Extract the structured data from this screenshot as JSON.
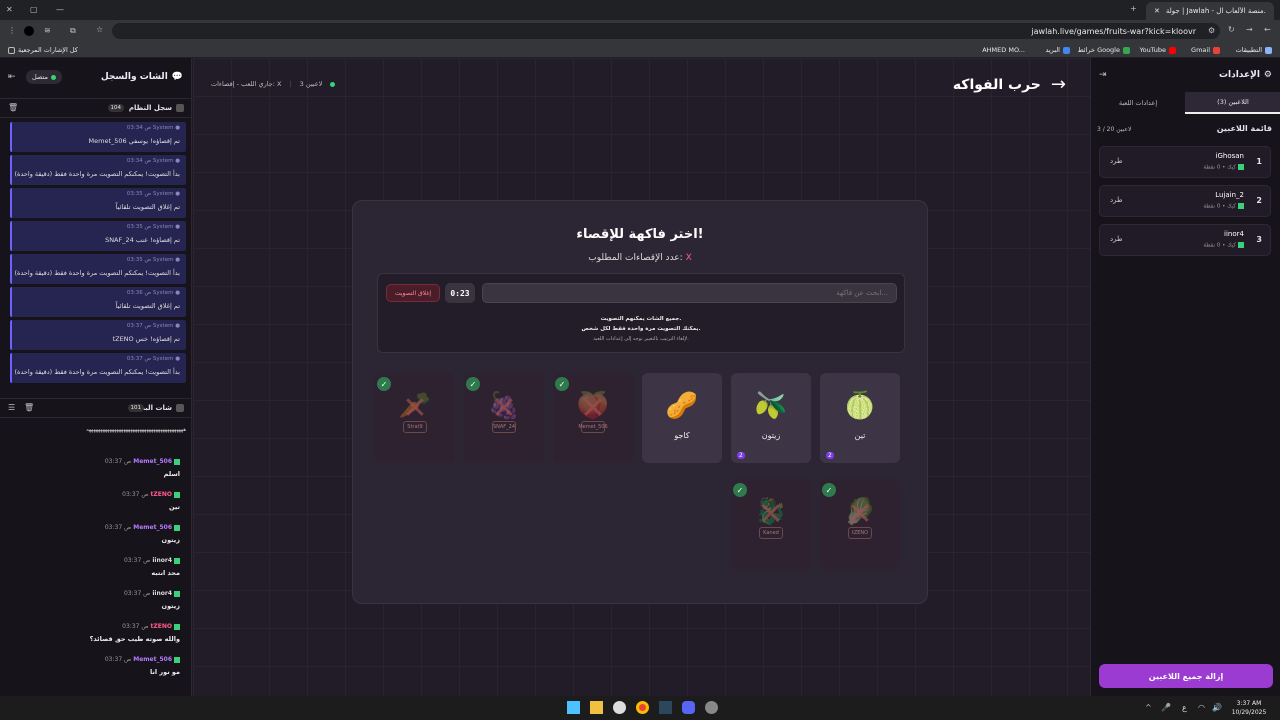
{
  "browser": {
    "tab_title": "جولة | Jawlah - منصة الألعاب ال...",
    "url": "jawlah.live/games/fruits-war?kick=kloovr",
    "bookmarks": [
      "التطبيقات",
      "Gmail",
      "YouTube",
      "خرائط Google",
      "البريد",
      "AHMED MO...",
      "كل الإشارات المرجعية"
    ]
  },
  "left": {
    "title": "الشات والسجل",
    "status": "متصل",
    "system_log_title": "سجل النظام",
    "system_log_count": "104",
    "system_messages": [
      {
        "sender": "System",
        "time": "03:34 ص",
        "text": "Memet_506 تم إقصاؤه! يوسفي"
      },
      {
        "sender": "System",
        "time": "03:34 ص",
        "text": "بدأ التصويت! يمكنكم التصويت مرة واحدة فقط (دقيقة واحدة)"
      },
      {
        "sender": "System",
        "time": "03:35 ص",
        "text": "تم إغلاق التصويت تلقائياً"
      },
      {
        "sender": "System",
        "time": "03:35 ص",
        "text": "SNAF_24 تم إقصاؤه! عنب"
      },
      {
        "sender": "System",
        "time": "03:35 ص",
        "text": "بدأ التصويت! يمكنكم التصويت مرة واحدة فقط (دقيقة واحدة)"
      },
      {
        "sender": "System",
        "time": "03:36 ص",
        "text": "تم إغلاق التصويت تلقائياً"
      },
      {
        "sender": "System",
        "time": "03:37 ص",
        "text": "tZENO تم إقصاؤه! خس"
      },
      {
        "sender": "System",
        "time": "03:37 ص",
        "text": "بدأ التصويت! يمكنكم التصويت مرة واحدة فقط (دقيقة واحدة)"
      }
    ],
    "chat_title": "شات البث",
    "chat_count": "101",
    "chat_spam": "ههههههههههههههههههههههههههههههههههههههههههه",
    "chat_messages": [
      {
        "user": "Memet_506",
        "time": "03:37 ص",
        "text": "اسلم",
        "color": "#b47cff"
      },
      {
        "user": "tZENO",
        "time": "03:37 ص",
        "text": "تين",
        "color": "#ff5c8a"
      },
      {
        "user": "Memet_506",
        "time": "03:37 ص",
        "text": "زيتون",
        "color": "#b47cff"
      },
      {
        "user": "iinor4",
        "time": "03:37 ص",
        "text": "محد انتبه",
        "color": "#dddddd"
      },
      {
        "user": "iinor4",
        "time": "03:37 ص",
        "text": "زيتون",
        "color": "#dddddd"
      },
      {
        "user": "tZENO",
        "time": "03:37 ص",
        "text": "والله صوته طيب حق قصائد؟",
        "color": "#ff5c8a"
      },
      {
        "user": "Memet_506",
        "time": "03:37 ص",
        "text": "مو نور انا",
        "color": "#b47cff"
      }
    ]
  },
  "center": {
    "status_left": "جاري اللعب - إقصاءات: X",
    "players_count": "3 لاعبين",
    "game_title": "حرب الفواكه",
    "card_title": "اختر فاكهة للإقصاء!",
    "required_label": "عدد الإقصاءات المطلوب:",
    "required_value": "X",
    "search_placeholder": "ابحث عن فاكهة...",
    "timer": "0:23",
    "close_vote": "إغلاق التصويت",
    "info1": "جميع الشات يمكنهم التصويت.",
    "info2": "يمكنك التصويت مرة واحدة فقط لكل شخص.",
    "info3": "لإلغاء الترتيب بالتغيير توجه إلى إعدادات اللعبة.",
    "fruits": [
      {
        "name": "تين",
        "emoji": "🍈",
        "votes": "2",
        "eliminated": false
      },
      {
        "name": "زيتون",
        "emoji": "🫒",
        "votes": "2",
        "eliminated": false
      },
      {
        "name": "كاجو",
        "emoji": "🥜",
        "votes": "",
        "eliminated": false
      },
      {
        "name": "Memet_506",
        "emoji": "🍑",
        "votes": "",
        "eliminated": true
      },
      {
        "name": "SNAF_24",
        "emoji": "🍇",
        "votes": "",
        "eliminated": true
      },
      {
        "name": "Strat9",
        "emoji": "🥕",
        "votes": "",
        "eliminated": true
      },
      {
        "name": "tZENO",
        "emoji": "🥬",
        "votes": "",
        "eliminated": true
      },
      {
        "name": "Kaned",
        "emoji": "🐉",
        "votes": "",
        "eliminated": true
      }
    ]
  },
  "right": {
    "title": "الإعدادات",
    "tab_players": "اللاعبين (3)",
    "tab_settings": "إعدادات اللعبة",
    "list_title": "قائمة اللاعبين",
    "list_count": "3 / 20 لاعبين",
    "kick": "طرد",
    "players": [
      {
        "rank": "1",
        "name": "iGhosan",
        "sub": "كيك • 0 نقطة"
      },
      {
        "rank": "2",
        "name": "Lujain_2",
        "sub": "كيك • 0 نقطة"
      },
      {
        "rank": "3",
        "name": "iinor4",
        "sub": "كيك • 0 نقطة"
      }
    ],
    "remove_all": "إزالة جميع اللاعبين"
  },
  "taskbar": {
    "time": "3:37 AM",
    "date": "10/29/2025",
    "lang": "ع"
  }
}
